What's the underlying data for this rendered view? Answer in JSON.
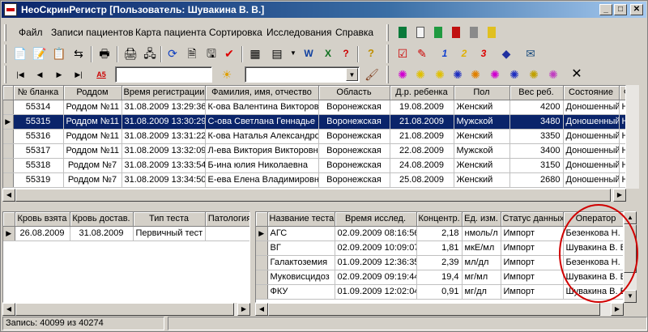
{
  "window": {
    "title": "НеоСкринРегистр  [Пользователь: Шувакина В. В.]",
    "minimize": "_",
    "maximize": "□",
    "close": "✕"
  },
  "menu": [
    "Файл",
    "Записи пациентов",
    "Карта пациента",
    "Сортировка",
    "Исследования",
    "Справка"
  ],
  "toolbar": {
    "text_btn_w": "W",
    "text_btn_x": "X",
    "text_btn_q": "?",
    "text_btn_1": "1",
    "text_btn_2": "2",
    "text_btn_3": "3",
    "sort_label": "A5",
    "q_icon": "?",
    "close_glyph": "✕"
  },
  "top_grid": {
    "columns": [
      "№ бланка",
      "Роддом",
      "Время регистрации",
      "Фамилия, имя, отчество",
      "Область",
      "Д.р. ребенка",
      "Пол",
      "Вес реб.",
      "Состояние",
      "Ф"
    ],
    "rows": [
      [
        "55314",
        "Роддом №11",
        "31.08.2009 13:29:36",
        "К-ова Валентина Викторов",
        "Воронежская",
        "19.08.2009",
        "Женский",
        "4200",
        "Доношенный",
        "Н"
      ],
      [
        "55315",
        "Роддом №11",
        "31.08.2009 13:30:29",
        "С-ова Светлана Геннадье",
        "Воронежская",
        "21.08.2009",
        "Мужской",
        "3480",
        "Доношенный",
        "Н"
      ],
      [
        "55316",
        "Роддом №11",
        "31.08.2009 13:31:22",
        "К-ова Наталья Александро",
        "Воронежская",
        "21.08.2009",
        "Женский",
        "3350",
        "Доношенный",
        "Н"
      ],
      [
        "55317",
        "Роддом №11",
        "31.08.2009 13:32:09",
        "Л-ева Виктория Викторовн",
        "Воронежская",
        "22.08.2009",
        "Мужской",
        "3400",
        "Доношенный",
        "Н"
      ],
      [
        "55318",
        "Роддом №7",
        "31.08.2009 13:33:54",
        "Б-ина юлия Николаевна",
        "Воронежская",
        "24.08.2009",
        "Женский",
        "3150",
        "Доношенный",
        "Н"
      ],
      [
        "55319",
        "Роддом №7",
        "31.08.2009 13:34:50",
        "Е-ева Елена Владимировна",
        "Воронежская",
        "25.08.2009",
        "Женский",
        "2680",
        "Доношенный",
        "Н"
      ]
    ],
    "selected_index": 1
  },
  "samples_grid": {
    "columns": [
      "Кровь взята",
      "Кровь достав.",
      "Тип теста",
      "Патология"
    ],
    "rows": [
      [
        "26.08.2009",
        "31.08.2009",
        "Первичный тест",
        ""
      ]
    ]
  },
  "tests_grid": {
    "columns": [
      "Название теста",
      "Время исслед.",
      "Концентр.",
      "Ед. изм.",
      "Статус данных",
      "Оператор"
    ],
    "rows": [
      [
        "АГС",
        "02.09.2009 08:16:56",
        "2,18",
        "нмоль/л",
        "Импорт",
        "Безенкова Н. Н."
      ],
      [
        "ВГ",
        "02.09.2009 10:09:07",
        "1,81",
        "мкЕ/мл",
        "Импорт",
        "Шувакина В. В."
      ],
      [
        "Галактоземия",
        "01.09.2009 12:36:35",
        "2,39",
        "мл/дл",
        "Импорт",
        "Безенкова Н. Н."
      ],
      [
        "Муковисцидоз",
        "02.09.2009 09:19:44",
        "19,4",
        "мг/мл",
        "Импорт",
        "Шувакина В. В."
      ],
      [
        "ФКУ",
        "01.09.2009 12:02:04",
        "0,91",
        "мг/дл",
        "Импорт",
        "Шувакина В. В."
      ]
    ]
  },
  "status": {
    "records": "Запись: 40099 из 40274"
  },
  "colors": {
    "selection": "#0a246a",
    "highlight_ellipse": "#d00000",
    "title_gradient_start": "#0a246a"
  }
}
